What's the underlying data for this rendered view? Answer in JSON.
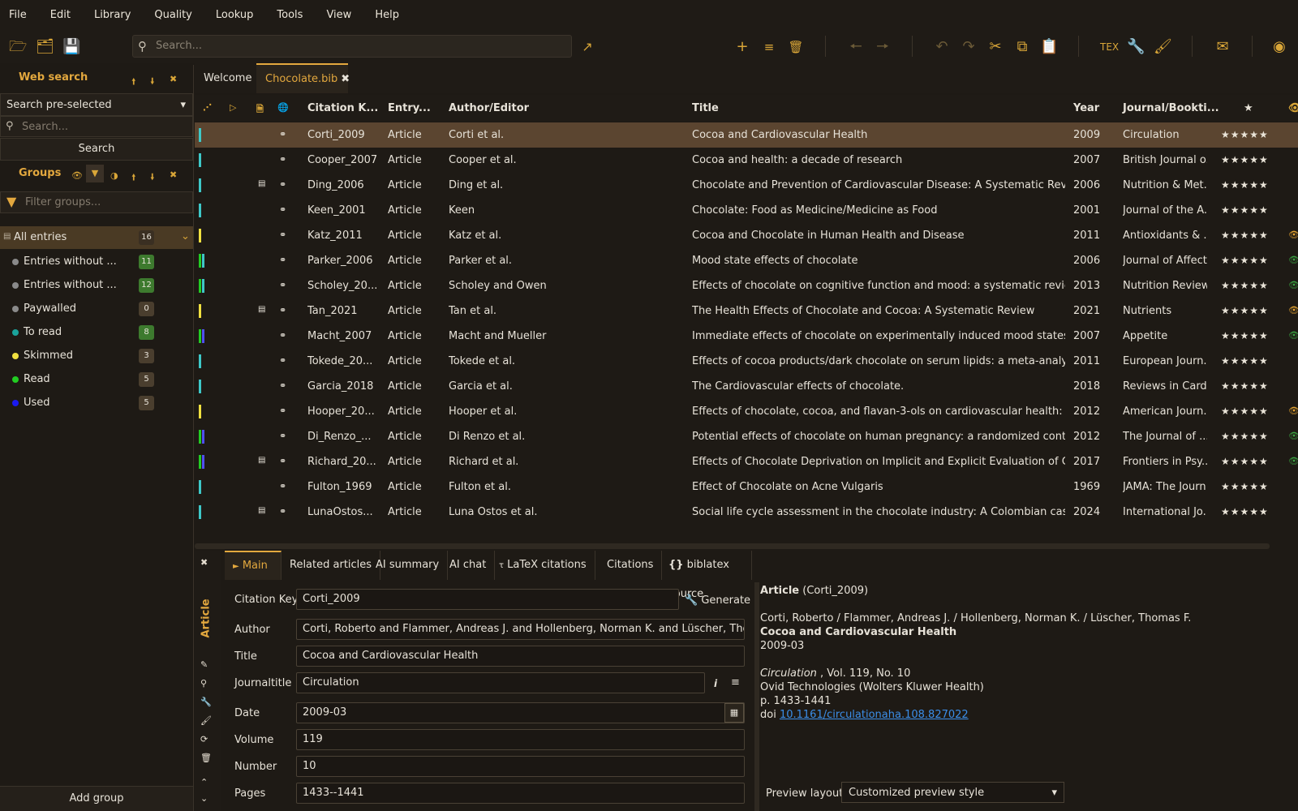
{
  "menu": [
    "File",
    "Edit",
    "Library",
    "Quality",
    "Lookup",
    "Tools",
    "View",
    "Help"
  ],
  "search": {
    "placeholder": "Search..."
  },
  "toolbar_icons": [
    "new-library-icon",
    "open-library-icon",
    "save-icon",
    "open-external-icon",
    "add-entry-icon",
    "add-multiple-icon",
    "delete-icon",
    "back-icon",
    "forward-icon",
    "undo-icon",
    "redo-icon",
    "cut-icon",
    "copy-icon",
    "paste-icon",
    "tex-icon",
    "key-icon",
    "clean-icon",
    "mail-icon",
    "github-icon"
  ],
  "web_search": {
    "title": "Web search",
    "preselect": "Search pre-selected",
    "placeholder": "Search...",
    "button": "Search"
  },
  "groups": {
    "title": "Groups",
    "filter_placeholder": "Filter groups...",
    "all": {
      "label": "All entries",
      "count": "16"
    },
    "items": [
      {
        "label": "Entries without ...",
        "count": "11",
        "dot": "#8a8a8a",
        "badge": "#3d7a2e"
      },
      {
        "label": "Entries without ...",
        "count": "12",
        "dot": "#8a8a8a",
        "badge": "#3d7a2e"
      },
      {
        "label": "Paywalled",
        "count": "0",
        "dot": "#8a8a8a",
        "badge": "#4a3e2e"
      },
      {
        "label": "To read",
        "count": "8",
        "dot": "#1aa39b",
        "badge": "#3d7a2e"
      },
      {
        "label": "Skimmed",
        "count": "3",
        "dot": "#f0e040",
        "badge": "#4a3e2e"
      },
      {
        "label": "Read",
        "count": "5",
        "dot": "#22cc22",
        "badge": "#4a3e2e"
      },
      {
        "label": "Used",
        "count": "5",
        "dot": "#1a1af0",
        "badge": "#4a3e2e"
      }
    ],
    "add": "Add group"
  },
  "tabs": [
    {
      "label": "Welcome"
    },
    {
      "label": "Chocolate.bib"
    }
  ],
  "columns": {
    "key": "Citation K...",
    "type": "Entry...",
    "author": "Author/Editor",
    "title": "Title",
    "year": "Year",
    "journal": "Journal/Bookti..."
  },
  "rows": [
    {
      "key": "Corti_2009",
      "type": "Article",
      "author": "Corti et al.",
      "title": "Cocoa and Cardiovascular Health",
      "year": "2009",
      "journal": "Circulation",
      "bars": [
        "#3ec8c8"
      ],
      "file": false,
      "eye": false,
      "sel": true
    },
    {
      "key": "Cooper_2007",
      "type": "Article",
      "author": "Cooper et al.",
      "title": "Cocoa and health: a decade of research",
      "year": "2007",
      "journal": "British Journal o...",
      "bars": [
        "#3ec8c8"
      ],
      "file": false,
      "eye": false
    },
    {
      "key": "Ding_2006",
      "type": "Article",
      "author": "Ding et al.",
      "title": "Chocolate and Prevention of Cardiovascular Disease: A Systematic Review",
      "year": "2006",
      "journal": "Nutrition & Met...",
      "bars": [
        "#3ec8c8"
      ],
      "file": true,
      "eye": false
    },
    {
      "key": "Keen_2001",
      "type": "Article",
      "author": "Keen",
      "title": "Chocolate: Food as Medicine/Medicine as Food",
      "year": "2001",
      "journal": "Journal of the A...",
      "bars": [
        "#3ec8c8"
      ],
      "file": false,
      "eye": false
    },
    {
      "key": "Katz_2011",
      "type": "Article",
      "author": "Katz et al.",
      "title": "Cocoa and Chocolate in Human Health and Disease",
      "year": "2011",
      "journal": "Antioxidants & ...",
      "bars": [
        "#f0e040"
      ],
      "file": false,
      "eye": "#e0a030"
    },
    {
      "key": "Parker_2006",
      "type": "Article",
      "author": "Parker et al.",
      "title": "Mood state effects of chocolate",
      "year": "2006",
      "journal": "Journal of Affect...",
      "bars": [
        "#22cc22",
        "#3ec8c8"
      ],
      "file": false,
      "eye": "#3aa040"
    },
    {
      "key": "Scholey_20...",
      "type": "Article",
      "author": "Scholey and Owen",
      "title": "Effects of chocolate on cognitive function and mood: a systematic review",
      "year": "2013",
      "journal": "Nutrition Reviews",
      "bars": [
        "#22cc22",
        "#3ec8c8"
      ],
      "file": false,
      "eye": "#3aa040"
    },
    {
      "key": "Tan_2021",
      "type": "Article",
      "author": "Tan et al.",
      "title": "The Health Effects of Chocolate and Cocoa: A Systematic Review",
      "year": "2021",
      "journal": "Nutrients",
      "bars": [
        "#f0e040"
      ],
      "file": true,
      "eye": "#e0a030"
    },
    {
      "key": "Macht_2007",
      "type": "Article",
      "author": "Macht and Mueller",
      "title": "Immediate effects of chocolate on experimentally induced mood states",
      "year": "2007",
      "journal": "Appetite",
      "bars": [
        "#22cc22",
        "#5050f0"
      ],
      "file": false,
      "eye": "#3aa040"
    },
    {
      "key": "Tokede_20...",
      "type": "Article",
      "author": "Tokede et al.",
      "title": "Effects of cocoa products/dark chocolate on serum lipids: a meta-analysis",
      "year": "2011",
      "journal": "European Journ...",
      "bars": [
        "#3ec8c8"
      ],
      "file": false,
      "eye": false
    },
    {
      "key": "Garcia_2018",
      "type": "Article",
      "author": "Garcia et al.",
      "title": "The Cardiovascular effects of chocolate.",
      "year": "2018",
      "journal": "Reviews in Cardi...",
      "bars": [
        "#3ec8c8"
      ],
      "file": false,
      "eye": false
    },
    {
      "key": "Hooper_20...",
      "type": "Article",
      "author": "Hooper et al.",
      "title": "Effects of chocolate, cocoa, and flavan-3-ols on cardiovascular health: a syste...",
      "year": "2012",
      "journal": "American Journ...",
      "bars": [
        "#f0e040"
      ],
      "file": false,
      "eye": "#e0a030"
    },
    {
      "key": "Di_Renzo_...",
      "type": "Article",
      "author": "Di Renzo et al.",
      "title": "Potential effects of chocolate on human pregnancy: a randomized controlled...",
      "year": "2012",
      "journal": "The Journal of ...",
      "bars": [
        "#22cc22",
        "#5050f0"
      ],
      "file": false,
      "eye": "#3aa040"
    },
    {
      "key": "Richard_20...",
      "type": "Article",
      "author": "Richard et al.",
      "title": "Effects of Chocolate Deprivation on Implicit and Explicit Evaluation of Chocol...",
      "year": "2017",
      "journal": "Frontiers in Psy...",
      "bars": [
        "#22cc22",
        "#5050f0"
      ],
      "file": true,
      "eye": "#3aa040"
    },
    {
      "key": "Fulton_1969",
      "type": "Article",
      "author": "Fulton et al.",
      "title": "Effect of Chocolate on Acne Vulgaris",
      "year": "1969",
      "journal": "JAMA: The Journ...",
      "bars": [
        "#3ec8c8"
      ],
      "file": false,
      "eye": false
    },
    {
      "key": "LunaOstos...",
      "type": "Article",
      "author": "Luna Ostos et al.",
      "title": "Social life cycle assessment in the chocolate industry: A Colombian case stud...",
      "year": "2024",
      "journal": "International Jo...",
      "bars": [
        "#3ec8c8"
      ],
      "file": true,
      "eye": false
    }
  ],
  "editor": {
    "type": "Article",
    "tabs": [
      "Main",
      "Related articles",
      "AI summary",
      "AI chat",
      "LaTeX citations",
      "Citations",
      "biblatex source"
    ],
    "fields": [
      {
        "label": "Citation Key",
        "value": "Corti_2009"
      },
      {
        "label": "Author",
        "value": "Corti, Roberto and Flammer, Andreas J. and Hollenberg, Norman K. and Lüscher, Thomas F."
      },
      {
        "label": "Title",
        "value": "Cocoa and Cardiovascular Health"
      },
      {
        "label": "Journaltitle",
        "value": "Circulation"
      },
      {
        "label": "Date",
        "value": "2009-03"
      },
      {
        "label": "Volume",
        "value": "119"
      },
      {
        "label": "Number",
        "value": "10"
      },
      {
        "label": "Pages",
        "value": "1433--1441"
      }
    ],
    "generate": "Generate"
  },
  "preview": {
    "type": "Article",
    "key": "(Corti_2009)",
    "authors": "Corti, Roberto / Flammer, Andreas J. / Hollenberg, Norman K. / Lüscher, Thomas F.",
    "title": "Cocoa and Cardiovascular Health",
    "date": "2009-03",
    "journal": "Circulation",
    "vol": " , Vol. 119, No. 10",
    "publisher": "Ovid Technologies (Wolters Kluwer Health)",
    "pages": "p. 1433-1441",
    "doi_label": "doi",
    "doi": "10.1161/circulationaha.108.827022",
    "layout_label": "Preview layout",
    "layout": "Customized preview style"
  },
  "colors": {
    "accent": "#e3a83e",
    "selected_row": "#5b4530",
    "background": "#1e1a15",
    "link": "#3b8ee8"
  }
}
